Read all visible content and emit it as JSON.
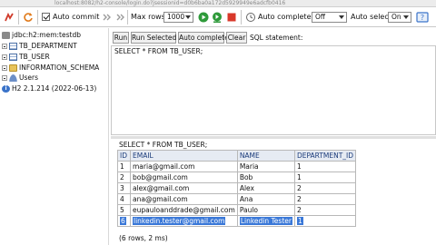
{
  "browser": {
    "url": "localhost:8082/h2-console/login.do?jsessionid=d0b6ba0a172d5929949e6adcfb0416"
  },
  "toolbar": {
    "auto_commit_label": "Auto commit",
    "auto_commit_checked": true,
    "max_rows_label": "Max rows:",
    "max_rows_value": "1000",
    "auto_complete_label": "Auto complete",
    "auto_complete_value": "Off",
    "auto_select_label": "Auto select",
    "auto_select_value": "On"
  },
  "tree": {
    "connection": "jdbc:h2:mem:testdb",
    "items": [
      {
        "label": "TB_DEPARTMENT",
        "icon": "table-icon"
      },
      {
        "label": "TB_USER",
        "icon": "table-icon"
      },
      {
        "label": "INFORMATION_SCHEMA",
        "icon": "folder-icon"
      },
      {
        "label": "Users",
        "icon": "users-icon"
      },
      {
        "label": "H2 2.1.214 (2022-06-13)",
        "icon": "info-icon"
      }
    ]
  },
  "editor_toolbar": {
    "run": "Run",
    "run_selected": "Run Selected",
    "auto_complete": "Auto complete",
    "clear": "Clear",
    "sql_statement_label": "SQL statement:"
  },
  "editor": {
    "sql": "SELECT * FROM TB_USER;"
  },
  "result": {
    "query": "SELECT * FROM TB_USER;",
    "columns": [
      "ID",
      "EMAIL",
      "NAME",
      "DEPARTMENT_ID"
    ],
    "rows": [
      [
        "1",
        "maria@gmail.com",
        "Maria",
        "1"
      ],
      [
        "2",
        "bob@gmail.com",
        "Bob",
        "1"
      ],
      [
        "3",
        "alex@gmail.com",
        "Alex",
        "2"
      ],
      [
        "4",
        "ana@gmail.com",
        "Ana",
        "2"
      ],
      [
        "5",
        "eupauloanddrade@gmail.com",
        "Paulo",
        "2"
      ],
      [
        "6",
        "linkedin.tester@gmail.com",
        "Linkedin Tester",
        "1"
      ]
    ],
    "summary": "(6 rows, 2 ms)"
  }
}
